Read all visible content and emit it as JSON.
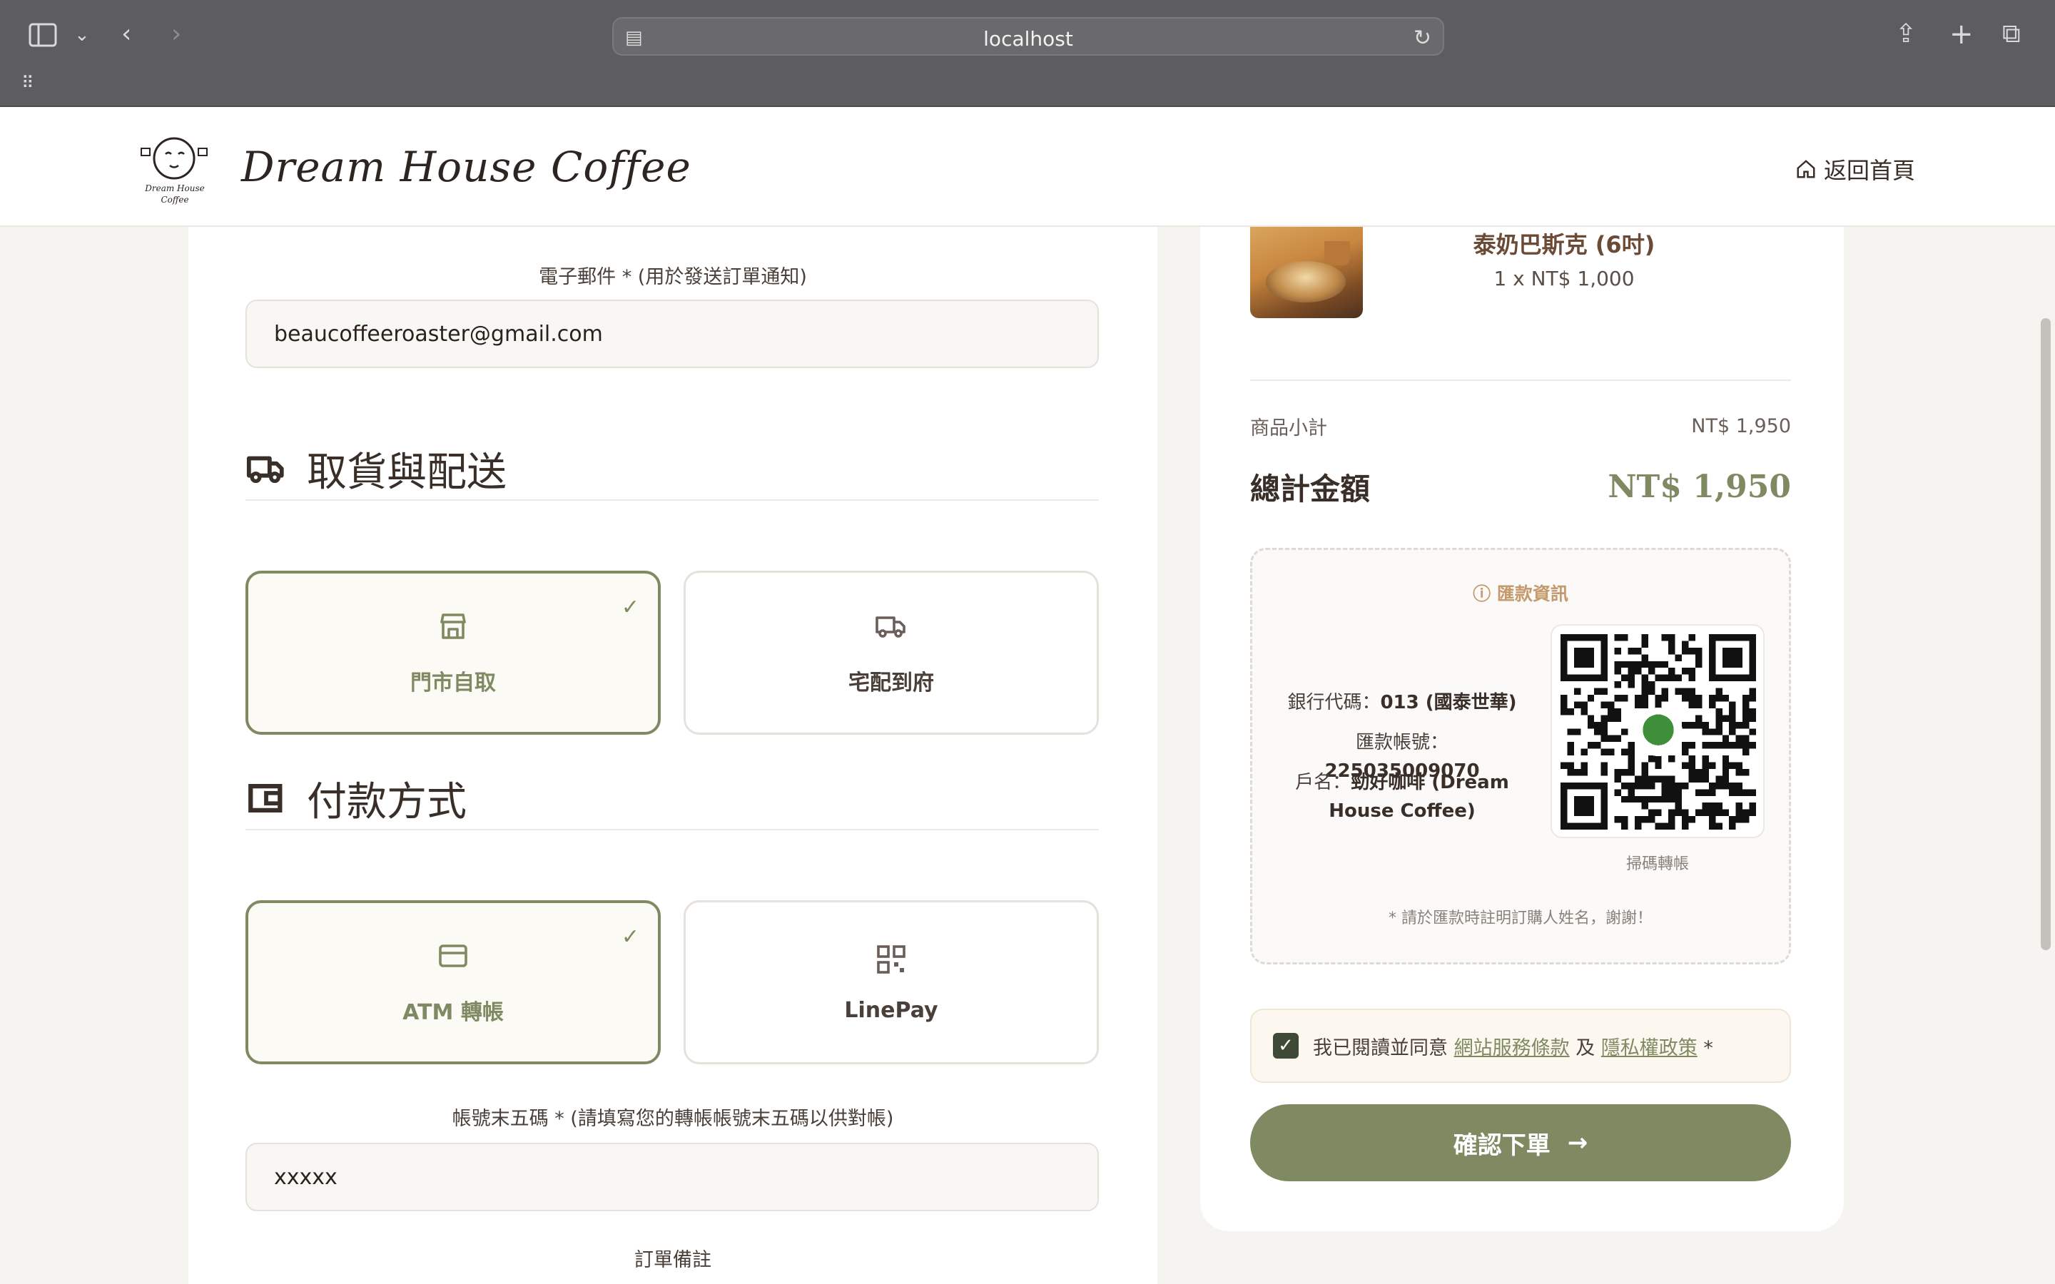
{
  "browser": {
    "url": "localhost"
  },
  "header": {
    "logo_text": "Dream House Coffee",
    "logo_mark_text_1": "Dream House",
    "logo_mark_text_2": "Coffee",
    "home_link": "返回首頁"
  },
  "form": {
    "email_label": "電子郵件 * (用於發送訂單通知)",
    "email_value": "beaucoffeeroaster@gmail.com",
    "delivery_title": "取貨與配送",
    "delivery_options": [
      {
        "label": "門市自取",
        "icon": "store-icon",
        "selected": true
      },
      {
        "label": "宅配到府",
        "icon": "truck-icon",
        "selected": false
      }
    ],
    "payment_title": "付款方式",
    "payment_options": [
      {
        "label": "ATM 轉帳",
        "icon": "card-icon",
        "selected": true
      },
      {
        "label": "LinePay",
        "icon": "qr-icon",
        "selected": false
      }
    ],
    "account_label": "帳號末五碼 * (請填寫您的轉帳帳號末五碼以供對帳)",
    "account_value": "xxxxx",
    "remarks_label": "訂單備註"
  },
  "summary": {
    "product_name": "泰奶巴斯克 (6吋)",
    "product_qty": "1 x NT$ 1,000",
    "subtotal_label": "商品小計",
    "subtotal_value": "NT$ 1,950",
    "total_label": "總計金額",
    "total_value": "NT$ 1,950",
    "transfer": {
      "title": "匯款資訊",
      "bank_label": "銀行代碼：",
      "bank_value": "013 (國泰世華)",
      "account_label": "匯款帳號：",
      "account_value": "225035009070",
      "holder_label": "戶名：",
      "holder_value": "勁好咖啡 (Dream",
      "holder_value_2": "House Coffee)",
      "scan_label": "掃碼轉帳",
      "note": "* 請於匯款時註明訂購人姓名，謝謝！"
    },
    "agree_prefix": "我已閱讀並同意",
    "agree_terms": "網站服務條款",
    "agree_and": "及",
    "agree_privacy": "隱私權政策",
    "agree_suffix": "*",
    "confirm_button": "確認下單"
  },
  "colors": {
    "accent": "#7f8a62",
    "brown": "#3a2f28",
    "gold": "#c49a6c"
  }
}
